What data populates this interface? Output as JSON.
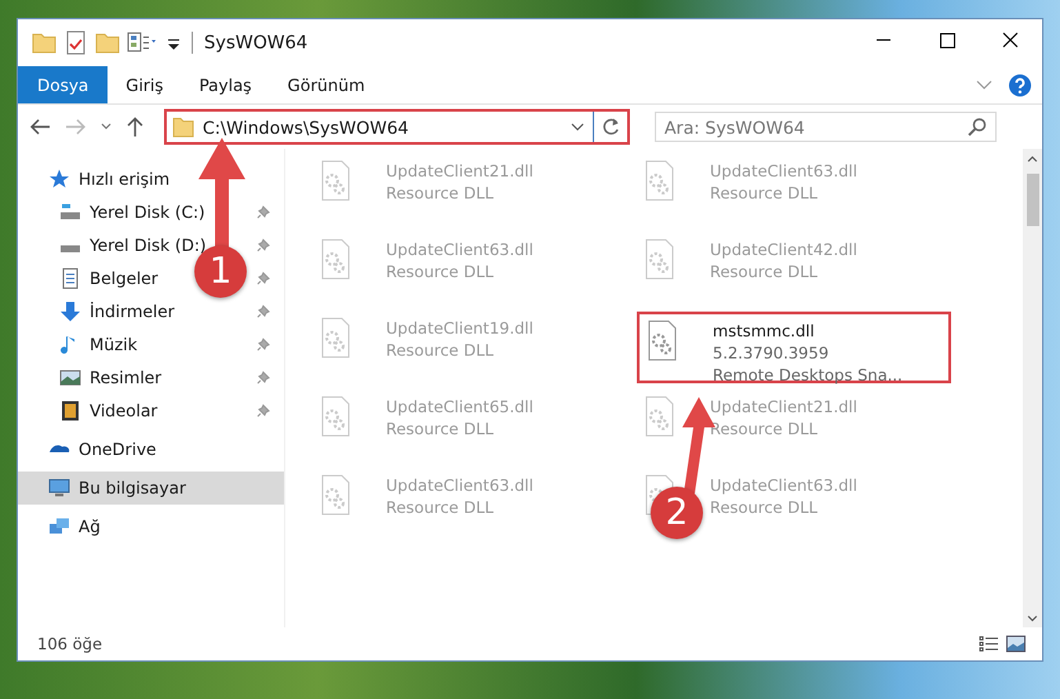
{
  "window": {
    "title": "SysWOW64"
  },
  "ribbon_tabs": [
    {
      "label": "Dosya",
      "selected": true
    },
    {
      "label": "Giriş",
      "selected": false
    },
    {
      "label": "Paylaş",
      "selected": false
    },
    {
      "label": "Görünüm",
      "selected": false
    }
  ],
  "address": {
    "path": "C:\\Windows\\SysWOW64",
    "highlighted": true
  },
  "search": {
    "placeholder": "Ara: SysWOW64"
  },
  "navigation": [
    {
      "label": "Hızlı erişim",
      "selected": false,
      "children": [
        {
          "label": "Yerel Disk (C:)",
          "pinned": true
        },
        {
          "label": "Yerel Disk (D:)",
          "pinned": true
        },
        {
          "label": "Belgeler",
          "pinned": true
        },
        {
          "label": "İndirmeler",
          "pinned": true
        },
        {
          "label": "Müzik",
          "pinned": true
        },
        {
          "label": "Resimler",
          "pinned": true
        },
        {
          "label": "Videolar",
          "pinned": true
        }
      ]
    },
    {
      "label": "OneDrive",
      "selected": false
    },
    {
      "label": "Bu bilgisayar",
      "selected": true
    },
    {
      "label": "Ağ",
      "selected": false
    }
  ],
  "files": [
    {
      "name": "UpdateClient21.dll",
      "details": [
        "Resource DLL"
      ],
      "highlighted": false
    },
    {
      "name": "UpdateClient63.dll",
      "details": [
        "Resource DLL"
      ],
      "highlighted": false
    },
    {
      "name": "UpdateClient63.dll",
      "details": [
        "Resource DLL"
      ],
      "highlighted": false
    },
    {
      "name": "UpdateClient42.dll",
      "details": [
        "Resource DLL"
      ],
      "highlighted": false
    },
    {
      "name": "UpdateClient19.dll",
      "details": [
        "Resource DLL"
      ],
      "highlighted": false
    },
    {
      "name": "mstsmmc.dll",
      "details": [
        "5.2.3790.3959",
        "Remote Desktops Sna..."
      ],
      "highlighted": true
    },
    {
      "name": "UpdateClient65.dll",
      "details": [
        "Resource DLL"
      ],
      "highlighted": false
    },
    {
      "name": "UpdateClient21.dll",
      "details": [
        "Resource DLL"
      ],
      "highlighted": false
    },
    {
      "name": "UpdateClient63.dll",
      "details": [
        "Resource DLL"
      ],
      "highlighted": false
    },
    {
      "name": "UpdateClient63.dll",
      "details": [
        "Resource DLL"
      ],
      "highlighted": false
    }
  ],
  "status_bar": {
    "item_count": "106 öğe"
  },
  "annotations": [
    {
      "label": "1"
    },
    {
      "label": "2"
    }
  ]
}
